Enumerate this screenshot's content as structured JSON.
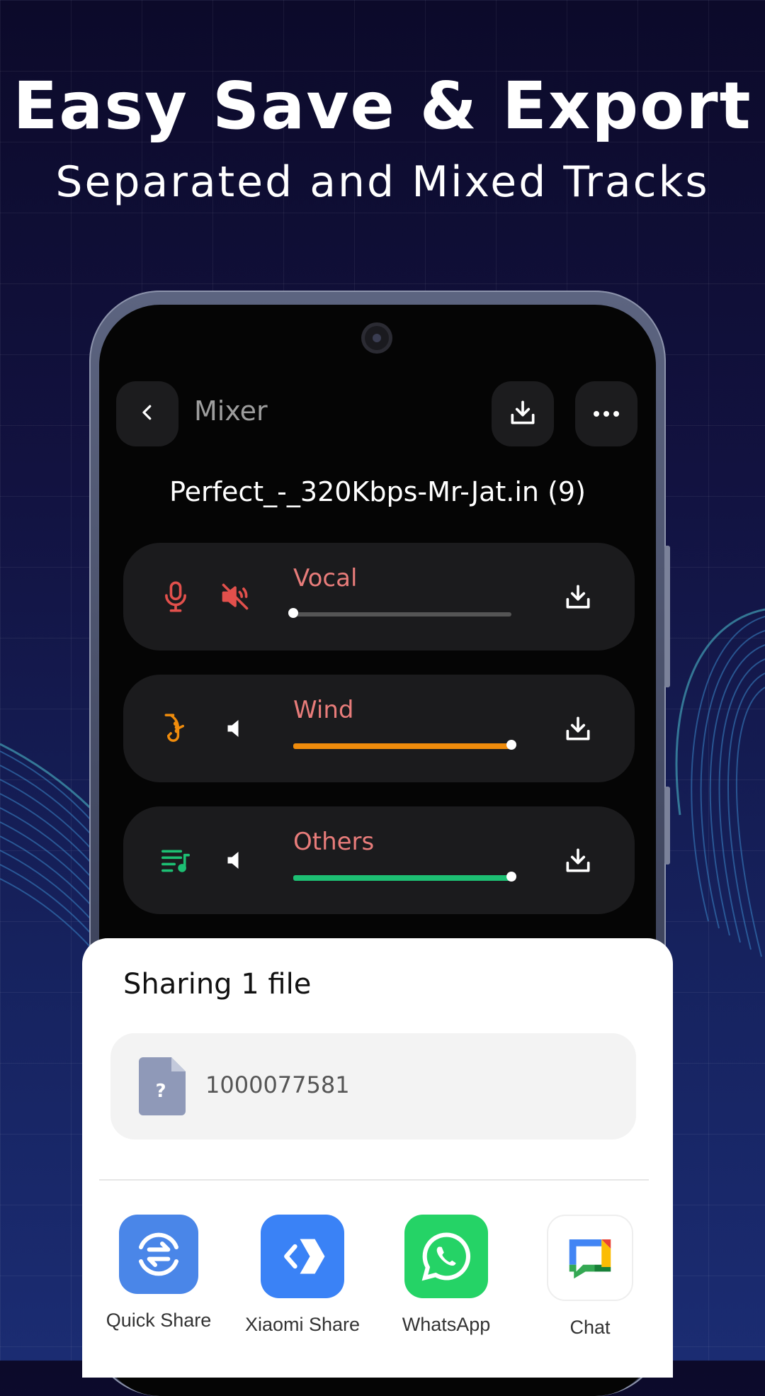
{
  "hero": {
    "title": "Easy Save & Export",
    "subtitle": "Separated and Mixed Tracks"
  },
  "app_bar": {
    "title": "Mixer",
    "back_icon": "chevron-left-icon",
    "download_icon": "download-icon",
    "more_icon": "more-horizontal-icon"
  },
  "song": {
    "title": "Perfect_-_320Kbps-Mr-Jat.in (9)"
  },
  "tracks": [
    {
      "label": "Vocal",
      "icon": "microphone-icon",
      "volume_icon": "volume-muted-icon",
      "level": 0.0,
      "color": "#e2504c",
      "muted": true
    },
    {
      "label": "Wind",
      "icon": "saxophone-icon",
      "volume_icon": "volume-icon",
      "level": 1.0,
      "color": "#f08c0c",
      "muted": false
    },
    {
      "label": "Others",
      "icon": "playlist-music-icon",
      "volume_icon": "volume-icon",
      "level": 1.0,
      "color": "#1dbf73",
      "muted": false
    }
  ],
  "share_sheet": {
    "title": "Sharing 1 file",
    "file_name": "1000077581",
    "file_icon": "unknown-file-icon",
    "apps": [
      {
        "name": "Quick Share",
        "icon": "quick-share-icon",
        "color": "#4285f4"
      },
      {
        "name": "Xiaomi Share",
        "icon": "xiaomi-share-icon",
        "color": "#3a82f6"
      },
      {
        "name": "WhatsApp",
        "icon": "whatsapp-icon",
        "color": "#25d366"
      },
      {
        "name": "Chat",
        "icon": "google-chat-icon",
        "color": "#ffffff"
      }
    ]
  }
}
